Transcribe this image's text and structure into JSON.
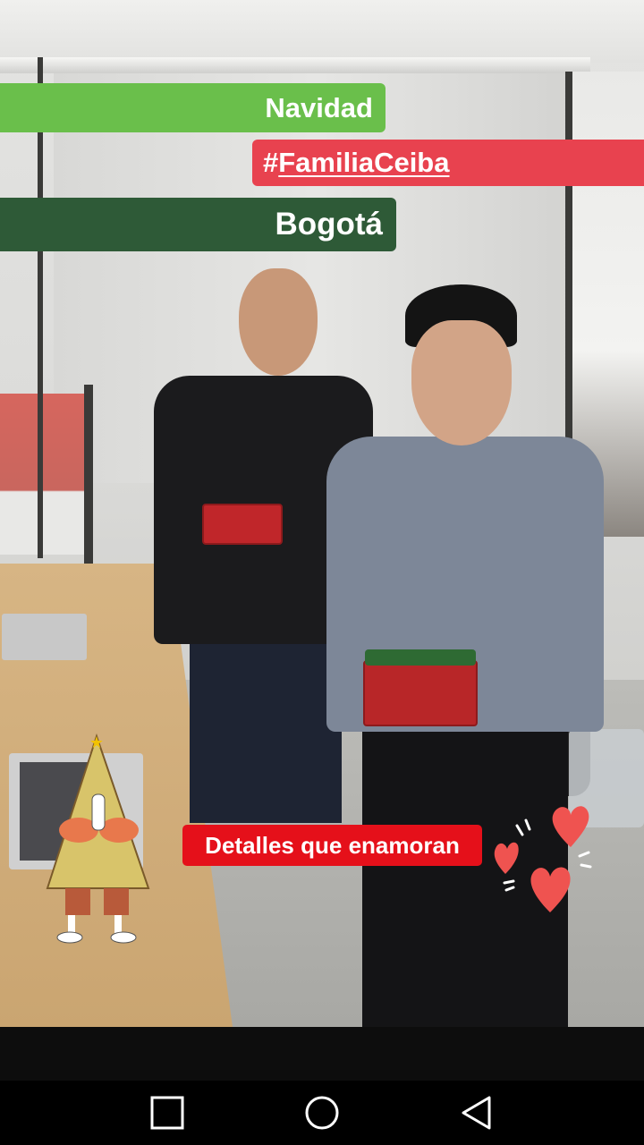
{
  "story": {
    "stickers": {
      "navidad": "Navidad",
      "hashtag_prefix": "#",
      "hashtag": "FamiliaCeiba",
      "location": "Bogotá",
      "caption": "Detalles que enamoran"
    },
    "colors": {
      "navidad_bg": "#6abf4b",
      "hashtag_bg": "#e8424f",
      "location_bg": "#2e5a37",
      "caption_bg": "#e5101a",
      "hearts": "#ef5350"
    }
  },
  "navbar": {
    "buttons": [
      "recents",
      "home",
      "back"
    ]
  }
}
